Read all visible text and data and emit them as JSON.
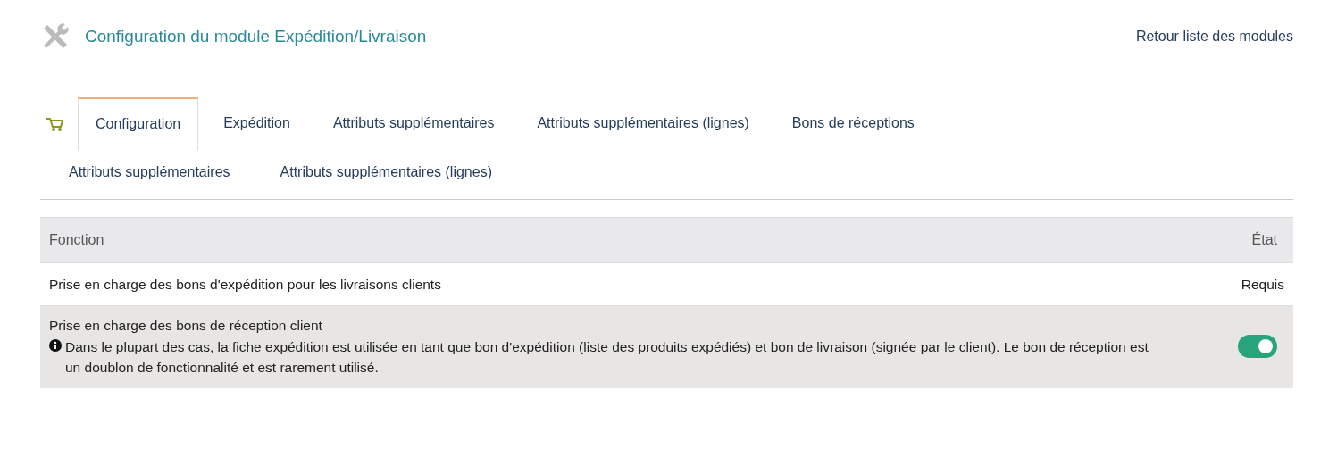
{
  "header": {
    "title": "Configuration du module Expédition/Livraison",
    "back_link": "Retour liste des modules"
  },
  "tabs": [
    {
      "label": "Configuration",
      "selected": true
    },
    {
      "label": "Expédition",
      "selected": false
    },
    {
      "label": "Attributs supplémentaires",
      "selected": false
    },
    {
      "label": "Attributs supplémentaires (lignes)",
      "selected": false
    },
    {
      "label": "Bons de réceptions",
      "selected": false
    },
    {
      "label": "Attributs supplémentaires",
      "selected": false
    },
    {
      "label": "Attributs supplémentaires (lignes)",
      "selected": false
    }
  ],
  "table": {
    "columns": [
      "Fonction",
      "État"
    ],
    "rows": [
      {
        "function": "Prise en charge des bons d'expédition pour les livraisons clients",
        "kind": "text",
        "state": "Requis"
      },
      {
        "function": "Prise en charge des bons de réception client",
        "note": "Dans le plupart des cas, la fiche expédition est utilisée en tant que bon d'expédition (liste des produits expédiés) et bon de livraison (signée par le client). Le bon de réception est un doublon de fonctionnalité et est rarement utilisé.",
        "kind": "toggle",
        "on": true
      }
    ]
  }
}
